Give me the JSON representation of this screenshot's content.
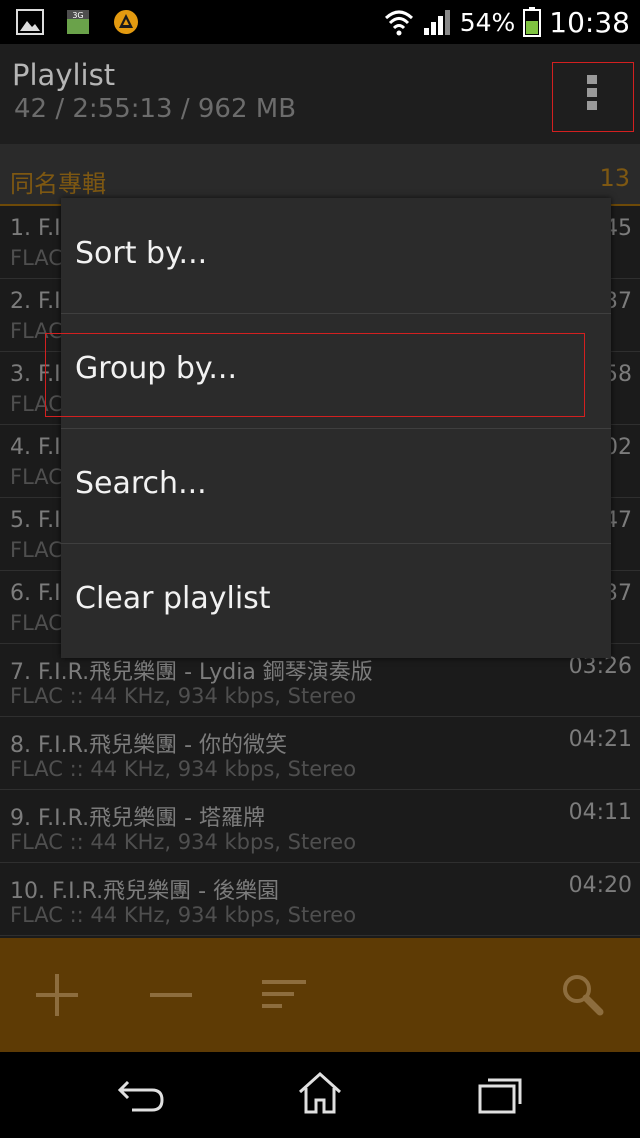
{
  "status_bar": {
    "battery_percent": "54%",
    "time": "10:38",
    "icons": [
      "image-icon",
      "3g-icon",
      "aimp-icon",
      "wifi-icon",
      "signal-icon",
      "battery-icon"
    ]
  },
  "header": {
    "title": "Playlist",
    "subtitle": "42 / 2:55:13 / 962 MB"
  },
  "group": {
    "name": "同名專輯",
    "count": "13"
  },
  "tracks": [
    {
      "title": "1. F.I.",
      "meta": "FLAC",
      "duration": "45"
    },
    {
      "title": "2. F.I.",
      "meta": "FLAC",
      "duration": "37"
    },
    {
      "title": "3. F.I.",
      "meta": "FLAC",
      "duration": "58"
    },
    {
      "title": "4. F.I.",
      "meta": "FLAC",
      "duration": "02"
    },
    {
      "title": "5. F.I.",
      "meta": "FLAC",
      "duration": "47"
    },
    {
      "title": "6. F.I.",
      "meta": "FLAC",
      "duration": "37"
    },
    {
      "title": "7. F.I.R.飛兒樂團 - Lydia 鋼琴演奏版",
      "meta": "FLAC :: 44 KHz, 934 kbps, Stereo",
      "duration": "03:26"
    },
    {
      "title": "8. F.I.R.飛兒樂團 - 你的微笑",
      "meta": "FLAC :: 44 KHz, 934 kbps, Stereo",
      "duration": "04:21"
    },
    {
      "title": "9. F.I.R.飛兒樂團 - 塔羅牌",
      "meta": "FLAC :: 44 KHz, 934 kbps, Stereo",
      "duration": "04:11"
    },
    {
      "title": "10. F.I.R.飛兒樂團 - 後樂園",
      "meta": "FLAC :: 44 KHz, 934 kbps, Stereo",
      "duration": "04:20"
    }
  ],
  "menu": {
    "items": [
      "Sort by...",
      "Group by...",
      "Search...",
      "Clear playlist"
    ]
  },
  "toolbar": {
    "icons": [
      "add-icon",
      "remove-icon",
      "sort-icon",
      "search-icon"
    ]
  },
  "navbar": {
    "icons": [
      "back-icon",
      "home-icon",
      "recent-apps-icon"
    ]
  },
  "colors": {
    "accent": "#5e3b05",
    "group_text": "#7e5812",
    "highlight": "#d32020"
  }
}
